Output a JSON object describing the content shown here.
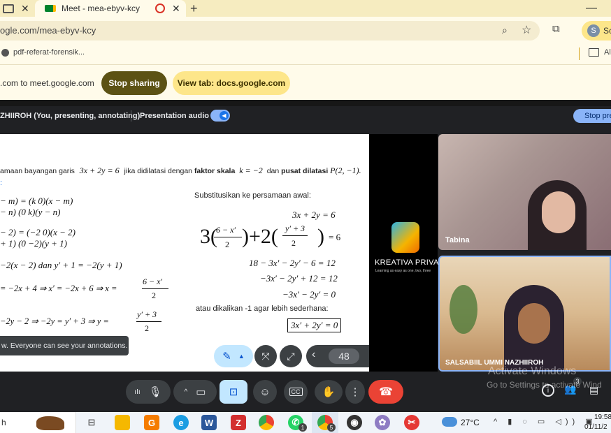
{
  "browser": {
    "tab_title": "Meet - mea-ebyv-kcy",
    "url": "ogle.com/mea-ebyv-kcy",
    "bookmark": "pdf-referat-forensik...",
    "profile_initial": "S",
    "profile_text": "Sc",
    "all_bookmarks": "Al"
  },
  "sharing_bar": {
    "message": ".com to meet.google.com",
    "stop_sharing": "Stop sharing",
    "view_tab": "View tab: docs.google.com"
  },
  "meet": {
    "presenter_label": "ZHIIROH (You, presenting, annotating)",
    "presentation_audio": "Presentation audio",
    "stop_presenting": "Stop pre",
    "slide_number": "48",
    "toast": "w. Everyone can see your annotations.",
    "participants": [
      {
        "name": "Tabina"
      },
      {
        "name": "SALSABIIL UMMI NAZHIIROH"
      }
    ],
    "people_count": "3",
    "logo_text": "KREATIVA PRIVAT",
    "logo_tagline": "Learning as easy as one, two, three"
  },
  "slide": {
    "title_line": {
      "prefix": "amaan bayangan garis",
      "eq": "3x + 2y = 6",
      "mid": "jika didilatasi dengan",
      "bold1": "faktor skala",
      "k": "k = −2",
      "mid2": "dan",
      "bold2": "pusat dilatasi",
      "p": "P(2, −1)."
    },
    "colon": ":",
    "left_lines": [
      "− m) = (k 0)(x − m)",
      "− n)   (0 k)(y − n)",
      "− 2) = (−2 0)(x − 2)",
      "+ 1)   (0 −2)(y + 1)",
      "−2(x − 2)   dan   y′ + 1 = −2(y + 1)",
      "= −2x + 4 ⇒ x′ = −2x + 6 ⇒ x =",
      "6 − x′",
      "2",
      "−2y − 2 ⇒ −2y = y′ + 3 ⇒ y =",
      "y′ + 3",
      "2"
    ],
    "right_heading": "Substitusikan ke persamaan awal:",
    "right_lines": [
      "3x + 2y = 6",
      "6 − x′",
      "2",
      "y′ + 3",
      "2",
      "= 6",
      "18 − 3x′ − 2y′ − 6 = 12",
      "−3x′ − 2y′ + 12 = 12",
      "−3x′ − 2y′ = 0",
      "3′x + 2y′ = 0"
    ],
    "simpler_note": "atau dikalikan -1 agar lebih sederhana:",
    "boxed_answer": "3x′ + 2y′ = 0"
  },
  "watermark": {
    "line1": "Activate Windows",
    "line2": "Go to Settings to activate Wind"
  },
  "taskbar": {
    "search_text": "h",
    "weather": "27°C",
    "time": "19:58",
    "date": "01/11/2",
    "whatsapp_badge": "1",
    "chrome_badge": "5"
  },
  "colors": {
    "tab_strip": "#f6ecc0",
    "stop_sharing_bg": "#5c5214",
    "view_tab_bg": "#fde68a",
    "end_call": "#ea4335",
    "accent_blue": "#8ab4f8"
  }
}
